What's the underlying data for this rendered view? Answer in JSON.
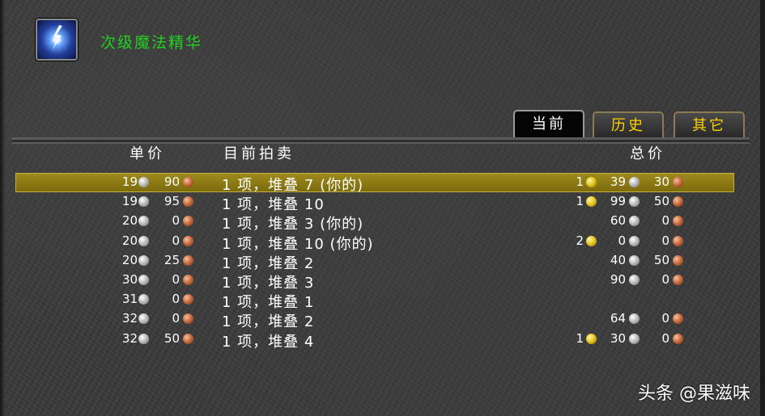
{
  "item": {
    "icon": "lightning-essence-icon",
    "name": "次级魔法精华"
  },
  "tabs": [
    {
      "label": "当前",
      "active": true
    },
    {
      "label": "历史",
      "active": false
    },
    {
      "label": "其它",
      "active": false
    }
  ],
  "columns": {
    "unit_price": "单价",
    "current_auction": "目前拍卖",
    "total_price": "总价"
  },
  "rows": [
    {
      "unit_silver": "19",
      "unit_copper": "90",
      "description": "1 项，堆叠 7 (你的)",
      "total_gold": "1",
      "total_silver": "39",
      "total_copper": "30",
      "selected": true
    },
    {
      "unit_silver": "19",
      "unit_copper": "95",
      "description": "1 项，堆叠 10",
      "total_gold": "1",
      "total_silver": "99",
      "total_copper": "50",
      "selected": false
    },
    {
      "unit_silver": "20",
      "unit_copper": "0",
      "description": "1 项，堆叠 3 (你的)",
      "total_gold": "",
      "total_silver": "60",
      "total_copper": "0",
      "selected": false
    },
    {
      "unit_silver": "20",
      "unit_copper": "0",
      "description": "1 项，堆叠 10 (你的)",
      "total_gold": "2",
      "total_silver": "0",
      "total_copper": "0",
      "selected": false
    },
    {
      "unit_silver": "20",
      "unit_copper": "25",
      "description": "1 项，堆叠 2",
      "total_gold": "",
      "total_silver": "40",
      "total_copper": "50",
      "selected": false
    },
    {
      "unit_silver": "30",
      "unit_copper": "0",
      "description": "1 项，堆叠 3",
      "total_gold": "",
      "total_silver": "90",
      "total_copper": "0",
      "selected": false
    },
    {
      "unit_silver": "31",
      "unit_copper": "0",
      "description": "1 项，堆叠 1",
      "total_gold": "",
      "total_silver": "",
      "total_copper": "",
      "selected": false
    },
    {
      "unit_silver": "32",
      "unit_copper": "0",
      "description": "1 项，堆叠 2",
      "total_gold": "",
      "total_silver": "64",
      "total_copper": "0",
      "selected": false
    },
    {
      "unit_silver": "32",
      "unit_copper": "50",
      "description": "1 项，堆叠 4",
      "total_gold": "1",
      "total_silver": "30",
      "total_copper": "0",
      "selected": false
    }
  ],
  "watermark": "头条 @果滋味",
  "colors": {
    "item_name": "#22d022",
    "tab_text": "#ffd200",
    "selected_row": "#8c7a14"
  }
}
